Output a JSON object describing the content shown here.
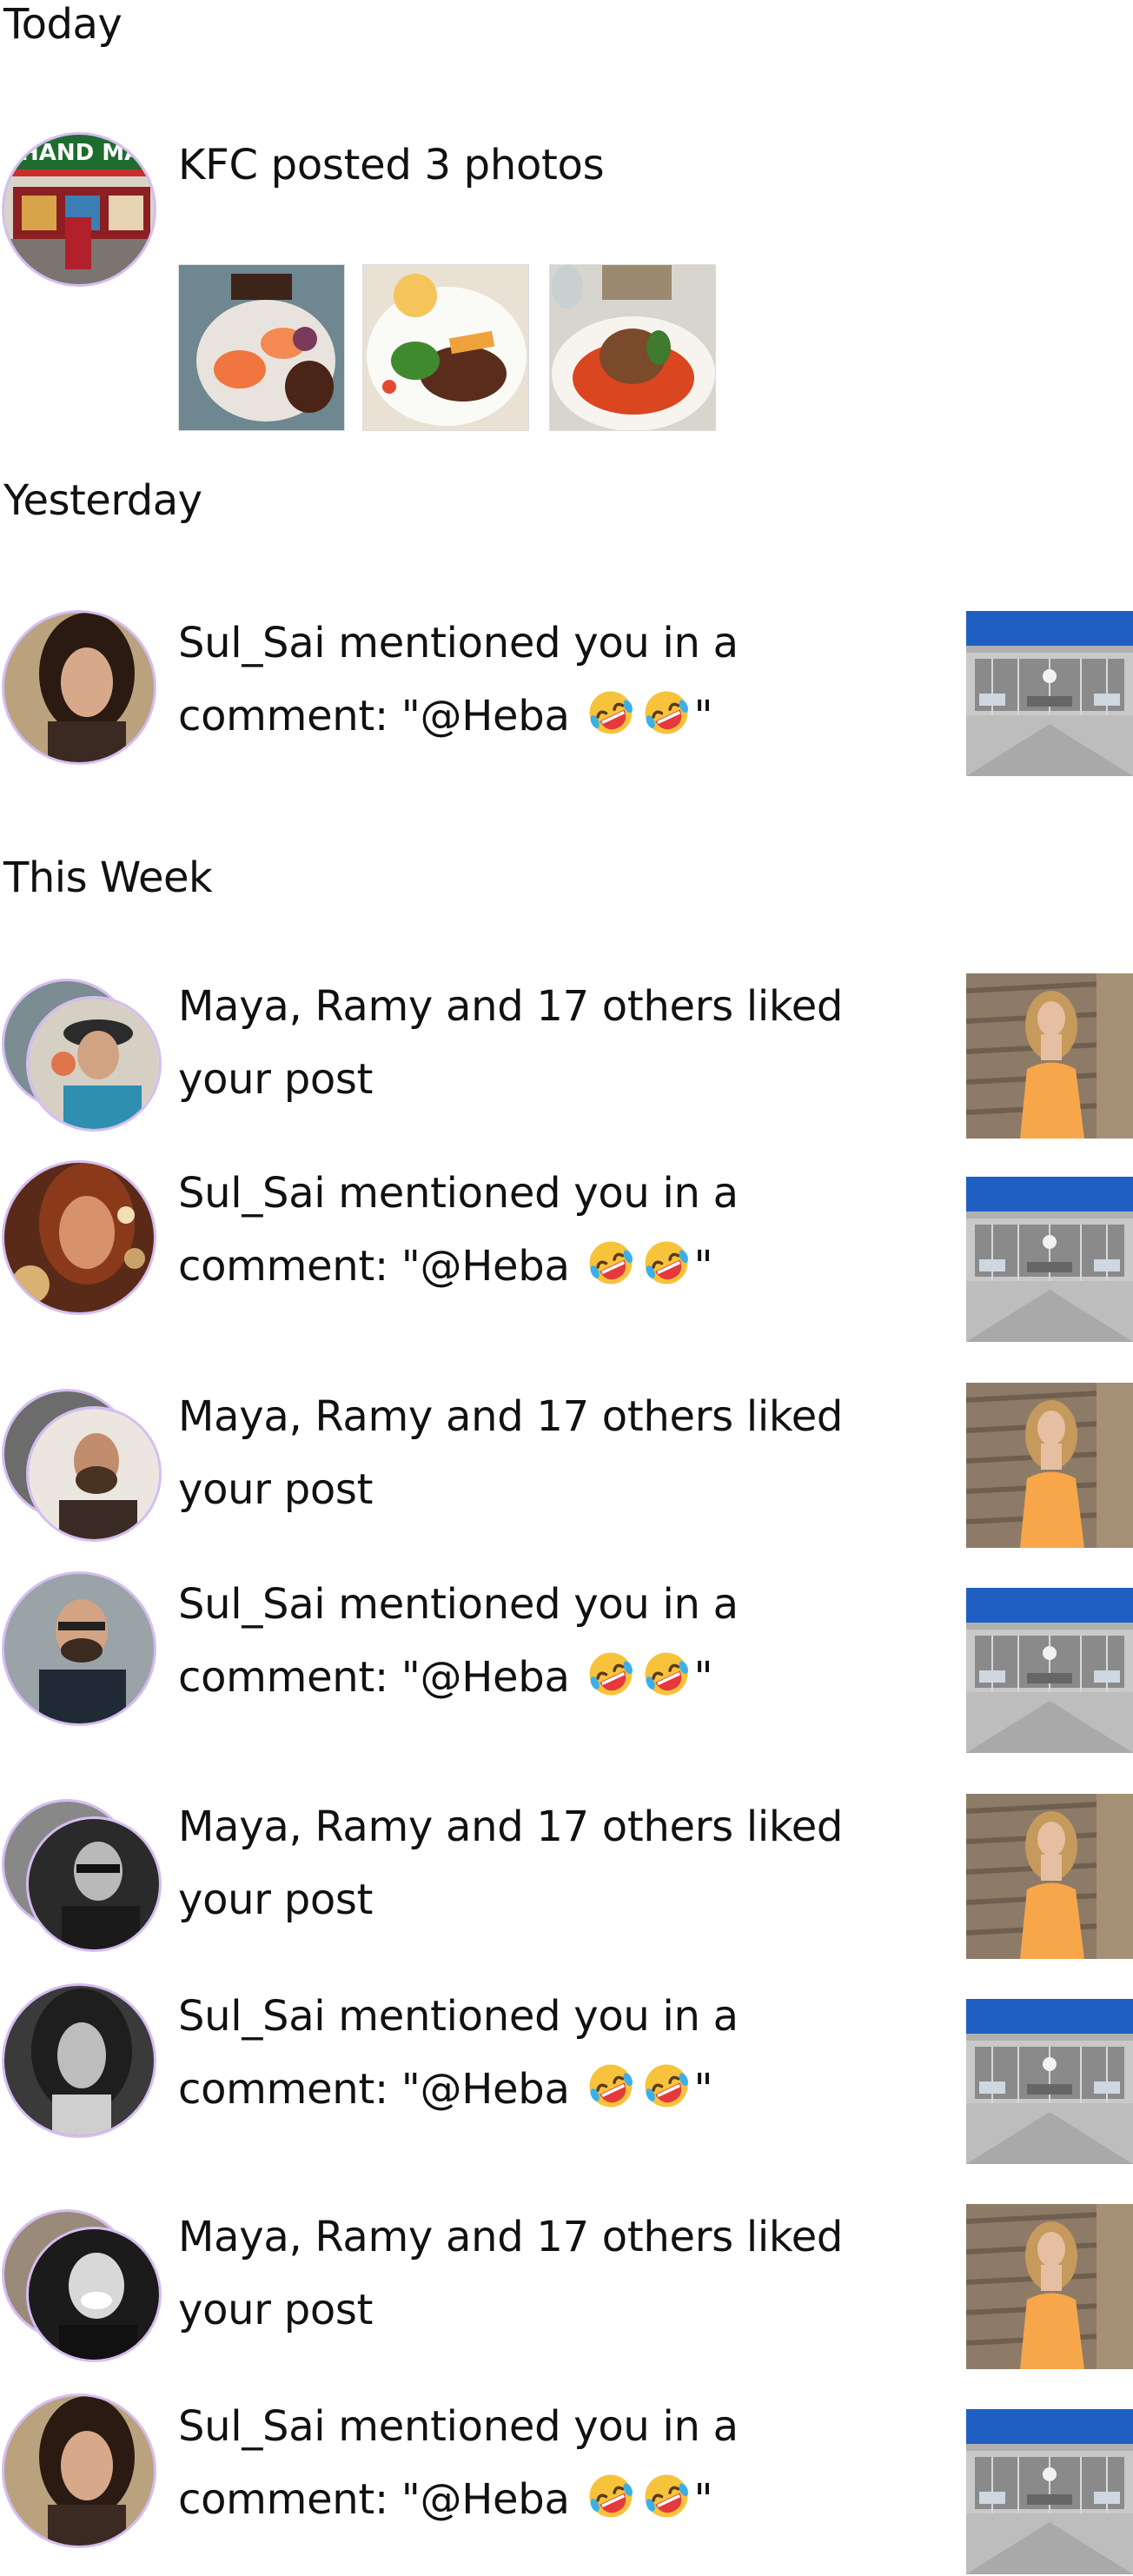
{
  "sections": {
    "today": "Today",
    "yesterday": "Yesterday",
    "this_week": "This Week"
  },
  "today": {
    "text": "KFC posted 3 photos",
    "avatar_sign": "HAND MA"
  },
  "yesterday": {
    "line1": "Sul_Sai mentioned you in a",
    "line2": "comment: \"@Heba",
    "quote_end": "\""
  },
  "week": [
    {
      "line1": "Maya, Ramy and 17 others liked",
      "line2": "your post"
    },
    {
      "line1": "Sul_Sai mentioned you in a",
      "line2": "comment: \"@Heba",
      "quote_end": "\""
    },
    {
      "line1": "Maya, Ramy and 17 others liked",
      "line2": "your post"
    },
    {
      "line1": "Sul_Sai mentioned you in a",
      "line2": "comment: \"@Heba",
      "quote_end": "\""
    },
    {
      "line1": "Maya, Ramy and 17 others liked",
      "line2": "your post"
    },
    {
      "line1": "Sul_Sai mentioned you in a",
      "line2": "comment: \"@Heba",
      "quote_end": "\""
    },
    {
      "line1": "Maya, Ramy and 17 others liked",
      "line2": "your post"
    },
    {
      "line1": "Sul_Sai mentioned you in a",
      "line2": "comment: \"@Heba",
      "quote_end": "\""
    }
  ],
  "colors": {
    "avatar_ring": "#d5bdf2",
    "text": "#111111",
    "apple_store_sky": "#1f5fc4",
    "dress_orange": "#f7a64a"
  },
  "icons": {
    "emoji": "rolling-on-floor-laughing-emoji"
  }
}
